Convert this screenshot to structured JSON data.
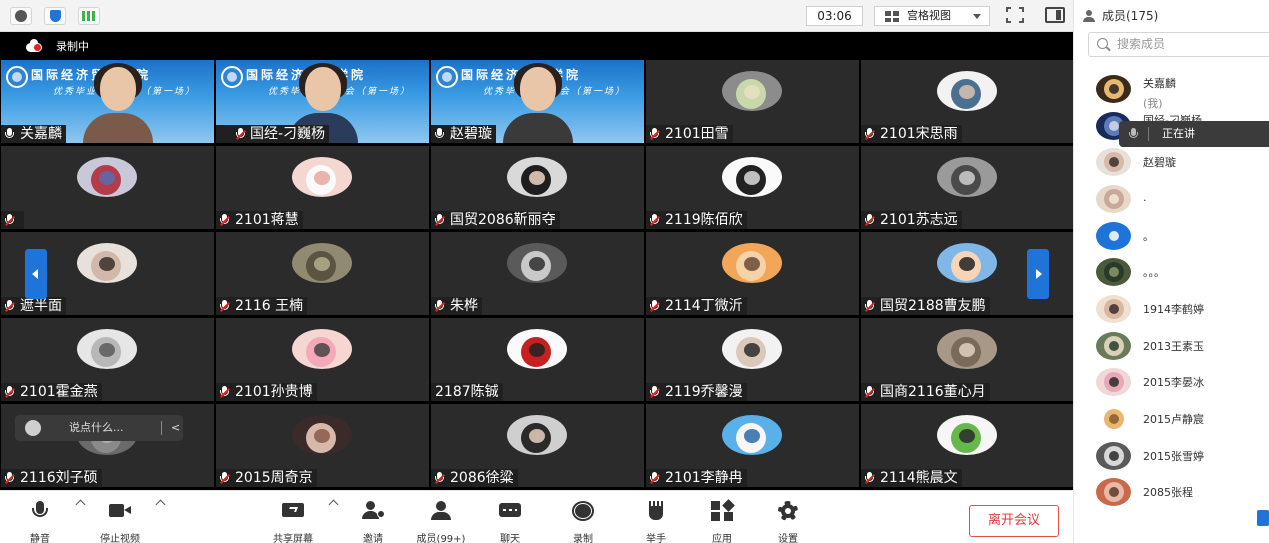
{
  "topbar": {
    "timer": "03:06",
    "view_label": "宫格视图"
  },
  "stage": {
    "recording_label": "录制中",
    "banner_title": "国际经济贸易学院",
    "banner_subtitle": "优秀毕业生分享会（第一场）",
    "chat_placeholder": "说点什么...",
    "chat_collapse": "<"
  },
  "tiles": [
    {
      "name": "关嘉麟",
      "mic": "on",
      "video": true,
      "host": false,
      "avatar": [
        "#2d84d4",
        "#e9c6a8",
        "#222"
      ]
    },
    {
      "name": "国经-刁巍杨",
      "mic": "muted",
      "video": true,
      "host": true,
      "avatar": [
        "#2d84d4",
        "#e9c6a8",
        "#222"
      ]
    },
    {
      "name": "赵碧璇",
      "mic": "on",
      "video": true,
      "host": false,
      "avatar": [
        "#2d84d4",
        "#e9c6a8",
        "#222"
      ]
    },
    {
      "name": "2101田雪",
      "mic": "muted",
      "video": false,
      "avatar": [
        "#8c8c8c",
        "#c9d8a8",
        "#e9e0c0"
      ]
    },
    {
      "name": "2101宋思雨",
      "mic": "muted",
      "video": false,
      "avatar": [
        "#f2f2f2",
        "#4b6f91",
        "#d9c2b2"
      ]
    },
    {
      "name": "",
      "mic": "muted",
      "video": false,
      "avatar": [
        "#c8c8d8",
        "#b33b4a",
        "#5a6bb0"
      ]
    },
    {
      "name": "2101蒋慧",
      "mic": "muted",
      "video": false,
      "avatar": [
        "#f3d7d0",
        "#fafafa",
        "#e8a6a0"
      ]
    },
    {
      "name": "国贸2086靳丽夺",
      "mic": "muted",
      "video": false,
      "avatar": [
        "#d9d9d9",
        "#1e1e1e",
        "#f0d7c4"
      ]
    },
    {
      "name": "2119陈佰欣",
      "mic": "muted",
      "video": false,
      "avatar": [
        "#fafafa",
        "#222",
        "#dcdcdc"
      ]
    },
    {
      "name": "2101苏志远",
      "mic": "muted",
      "video": false,
      "avatar": [
        "#9a9a9a",
        "#4a4a4a",
        "#d0d0d0"
      ]
    },
    {
      "name": "遮半面",
      "mic": "muted",
      "video": false,
      "avatar": [
        "#e8e0da",
        "#d2b8a8",
        "#3a2f2a"
      ]
    },
    {
      "name": "2116 王楠",
      "mic": "muted",
      "video": false,
      "avatar": [
        "#8f8a70",
        "#5a5440",
        "#b5ae8c"
      ]
    },
    {
      "name": "朱桦",
      "mic": "muted",
      "video": false,
      "avatar": [
        "#5a5a5a",
        "#c9c9c9",
        "#2e2e2e"
      ]
    },
    {
      "name": "2114丁微沂",
      "mic": "muted",
      "video": false,
      "avatar": [
        "#f2a65a",
        "#f6d2a8",
        "#6a4a3a"
      ]
    },
    {
      "name": "国贸2188曹友鹏",
      "mic": "muted",
      "video": false,
      "avatar": [
        "#7fb7e8",
        "#f5d5b5",
        "#222"
      ]
    },
    {
      "name": "2101霍金燕",
      "mic": "muted",
      "video": false,
      "avatar": [
        "#e6e6e6",
        "#b8b8b8",
        "#5a5a5a"
      ]
    },
    {
      "name": "2101孙贵博",
      "mic": "muted",
      "video": false,
      "avatar": [
        "#f6d6d0",
        "#f3a9b8",
        "#444"
      ]
    },
    {
      "name": "2187陈铖",
      "mic": "none",
      "video": false,
      "avatar": [
        "#fafafa",
        "#c6201f",
        "#222"
      ]
    },
    {
      "name": "2119乔馨漫",
      "mic": "muted",
      "video": false,
      "avatar": [
        "#f2f2f2",
        "#dcc8b8",
        "#2a2a2a"
      ]
    },
    {
      "name": "国商2116董心月",
      "mic": "muted",
      "video": false,
      "avatar": [
        "#a89888",
        "#7a6a5a",
        "#e0d0c0"
      ]
    },
    {
      "name": "2116刘子硕",
      "mic": "muted",
      "video": false,
      "avatar": [
        "#6a6a6a",
        "#8a8a8a",
        "#b0b0b0"
      ]
    },
    {
      "name": "2015周奇京",
      "mic": "muted",
      "video": false,
      "avatar": [
        "#3a2a2a",
        "#d8b8a8",
        "#8a5a4a"
      ]
    },
    {
      "name": "2086徐粱",
      "mic": "muted",
      "video": false,
      "avatar": [
        "#cfcfcf",
        "#2a2a2a",
        "#e8d0c0"
      ]
    },
    {
      "name": "2101李静冉",
      "mic": "muted",
      "video": false,
      "avatar": [
        "#5ab0e8",
        "#f6f6f6",
        "#2a6aa8"
      ]
    },
    {
      "name": "2114熊晨文",
      "mic": "muted",
      "video": false,
      "avatar": [
        "#f6f6f6",
        "#66b84a",
        "#2a2a2a"
      ]
    }
  ],
  "toolbar": {
    "mute": "静音",
    "stop_video": "停止视频",
    "share_screen": "共享屏幕",
    "invite": "邀请",
    "members": "成员(99+)",
    "chat": "聊天",
    "record": "录制",
    "raise_hand": "举手",
    "apps": "应用",
    "settings": "设置",
    "leave": "离开会议"
  },
  "sidepanel": {
    "title": "成员(175)",
    "search_placeholder": "搜索成员",
    "speaking_label": "正在讲",
    "members": [
      {
        "name": "关嘉麟",
        "sub": "(我)",
        "avatar": [
          "#3a2a1a",
          "#e8b870",
          "#222"
        ]
      },
      {
        "name": "国经-刁巍杨",
        "sub": "(主持人",
        "avatar": [
          "#1a2a5a",
          "#5a7ab8",
          "#d8d8e8"
        ]
      },
      {
        "name": "赵碧璇",
        "sub": "",
        "avatar": [
          "#e8e0da",
          "#d8b8a8",
          "#3a2f2a"
        ]
      },
      {
        "name": ".",
        "sub": "",
        "avatar": [
          "#e8d8c8",
          "#c8a898",
          "#f6e6d6"
        ]
      },
      {
        "name": "。",
        "sub": "",
        "avatar": [
          "#1e74d8",
          "#1e74d8",
          "#ffffff"
        ]
      },
      {
        "name": "。。。",
        "sub": "",
        "avatar": [
          "#4a5a3a",
          "#2a3a2a",
          "#8a9a6a"
        ]
      },
      {
        "name": "1914李鹤婷",
        "sub": "",
        "avatar": [
          "#f0e0d0",
          "#d8b8a0",
          "#3a2a2a"
        ]
      },
      {
        "name": "2013王素玉",
        "sub": "",
        "avatar": [
          "#6a7a5a",
          "#d8d0b8",
          "#2a3a2a"
        ]
      },
      {
        "name": "2015李晏冰",
        "sub": "",
        "avatar": [
          "#f0d8d8",
          "#e8a8b8",
          "#2a2a2a"
        ]
      },
      {
        "name": "2015卢静宸",
        "sub": "",
        "avatar": [
          "#ffffff",
          "#e8b870",
          "#8a5a2a"
        ]
      },
      {
        "name": "2015张雪婷",
        "sub": "",
        "avatar": [
          "#5a5a5a",
          "#d8d8d8",
          "#2a2a2a"
        ]
      },
      {
        "name": "2085张程",
        "sub": "",
        "avatar": [
          "#c86a4a",
          "#e8b8a8",
          "#5a3a2a"
        ]
      }
    ]
  },
  "colors": {
    "accent": "#1e74d8",
    "leave": "#e03a3a",
    "stage": "#000000",
    "tile": "#2b2b2b"
  }
}
